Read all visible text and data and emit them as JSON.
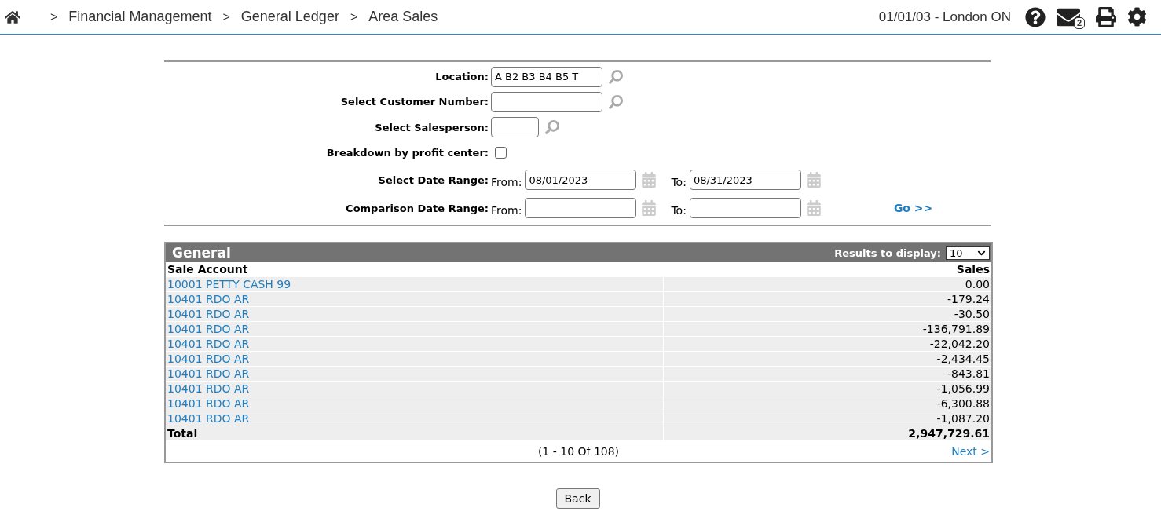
{
  "breadcrumb": [
    {
      "separator": ">",
      "label": "Financial Management"
    },
    {
      "separator": ">",
      "label": "General Ledger"
    },
    {
      "separator": ">",
      "label": "Area Sales"
    }
  ],
  "header": {
    "context": "01/01/03 - London ON",
    "message_count": "2"
  },
  "filters": {
    "location": {
      "label": "Location:",
      "value": "A B2 B3 B4 B5 T"
    },
    "customer": {
      "label": "Select Customer Number:"
    },
    "salesperson": {
      "label": "Select Salesperson:"
    },
    "breakdown": {
      "label": "Breakdown by profit center:",
      "checked": false
    },
    "date_range": {
      "label": "Select Date Range:",
      "from_label": "From:",
      "from": "08/01/2023",
      "to_label": "To:",
      "to": "08/31/2023"
    },
    "comparison_range": {
      "label": "Comparison Date Range:",
      "from_label": "From:",
      "to_label": "To:"
    },
    "go": "Go >>"
  },
  "panel": {
    "title": "General",
    "results_label": "Results to display:",
    "results_value": "10",
    "columns": [
      "Sale Account",
      "Sales"
    ],
    "rows": [
      {
        "account": "10001 PETTY CASH 99",
        "sales": "0.00"
      },
      {
        "account": "10401 RDO AR",
        "sales": "-179.24"
      },
      {
        "account": "10401 RDO AR",
        "sales": "-30.50"
      },
      {
        "account": "10401 RDO AR",
        "sales": "-136,791.89"
      },
      {
        "account": "10401 RDO AR",
        "sales": "-22,042.20"
      },
      {
        "account": "10401 RDO AR",
        "sales": "-2,434.45"
      },
      {
        "account": "10401 RDO AR",
        "sales": "-843.81"
      },
      {
        "account": "10401 RDO AR",
        "sales": "-1,056.99"
      },
      {
        "account": "10401 RDO AR",
        "sales": "-6,300.88"
      },
      {
        "account": "10401 RDO AR",
        "sales": "-1,087.20"
      }
    ],
    "total_label": "Total",
    "total": "2,947,729.61",
    "pagination": "(1 - 10 Of 108)",
    "next": "Next >"
  },
  "back": "Back"
}
